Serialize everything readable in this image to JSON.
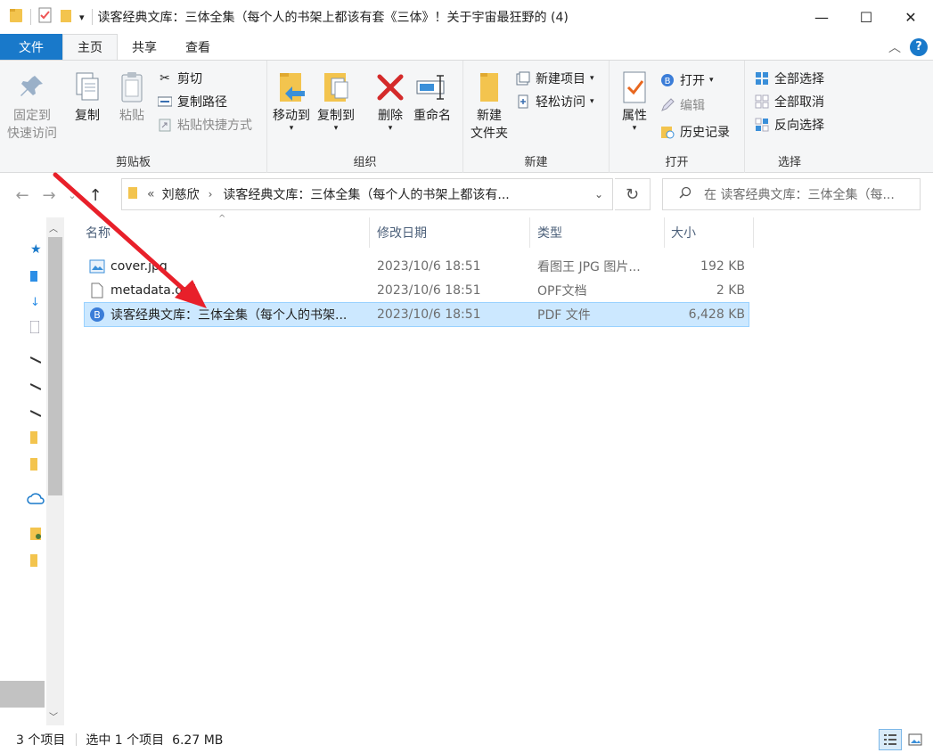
{
  "window": {
    "title": "读客经典文库：三体全集（每个人的书架上都该有套《三体》！关于宇宙最狂野的 (4)",
    "controls": [
      "—",
      "☐",
      "✕"
    ]
  },
  "tabs": {
    "file": "文件",
    "home": "主页",
    "share": "共享",
    "view": "查看"
  },
  "ribbon": {
    "clipboard": {
      "name": "剪贴板",
      "pin_line1": "固定到",
      "pin_line2": "快速访问",
      "copy": "复制",
      "paste": "粘贴",
      "cut": "剪切",
      "copy_path": "复制路径",
      "paste_shortcut": "粘贴快捷方式"
    },
    "organize": {
      "name": "组织",
      "move_to": "移动到",
      "copy_to": "复制到",
      "delete": "删除",
      "rename": "重命名"
    },
    "new": {
      "name": "新建",
      "new_folder_line1": "新建",
      "new_folder_line2": "文件夹",
      "new_item": "新建项目",
      "easy_access": "轻松访问"
    },
    "open": {
      "name": "打开",
      "properties": "属性",
      "open": "打开",
      "edit": "编辑",
      "history": "历史记录"
    },
    "select": {
      "name": "选择",
      "select_all": "全部选择",
      "select_none": "全部取消",
      "invert": "反向选择"
    }
  },
  "address": {
    "prefix": "«",
    "crumb1": "刘慈欣",
    "crumb2": "读客经典文库：三体全集（每个人的书架上都该有...",
    "search_placeholder": "在 读客经典文库：三体全集（每..."
  },
  "columns": {
    "name": "名称",
    "date": "修改日期",
    "type": "类型",
    "size": "大小"
  },
  "files": [
    {
      "name": "cover.jpg",
      "date": "2023/10/6 18:51",
      "type": "看图王 JPG 图片...",
      "size": "192 KB"
    },
    {
      "name": "metadata.opf",
      "date": "2023/10/6 18:51",
      "type": "OPF文档",
      "size": "2 KB"
    },
    {
      "name": "读客经典文库：三体全集（每个人的书架...",
      "date": "2023/10/6 18:51",
      "type": "PDF 文件",
      "size": "6,428 KB"
    }
  ],
  "status": {
    "count": "3 个项目",
    "selection": "选中 1 个项目  6.27 MB"
  },
  "colors": {
    "accent": "#1979ca",
    "selection": "#cce8ff",
    "arrow": "#e8202a"
  }
}
